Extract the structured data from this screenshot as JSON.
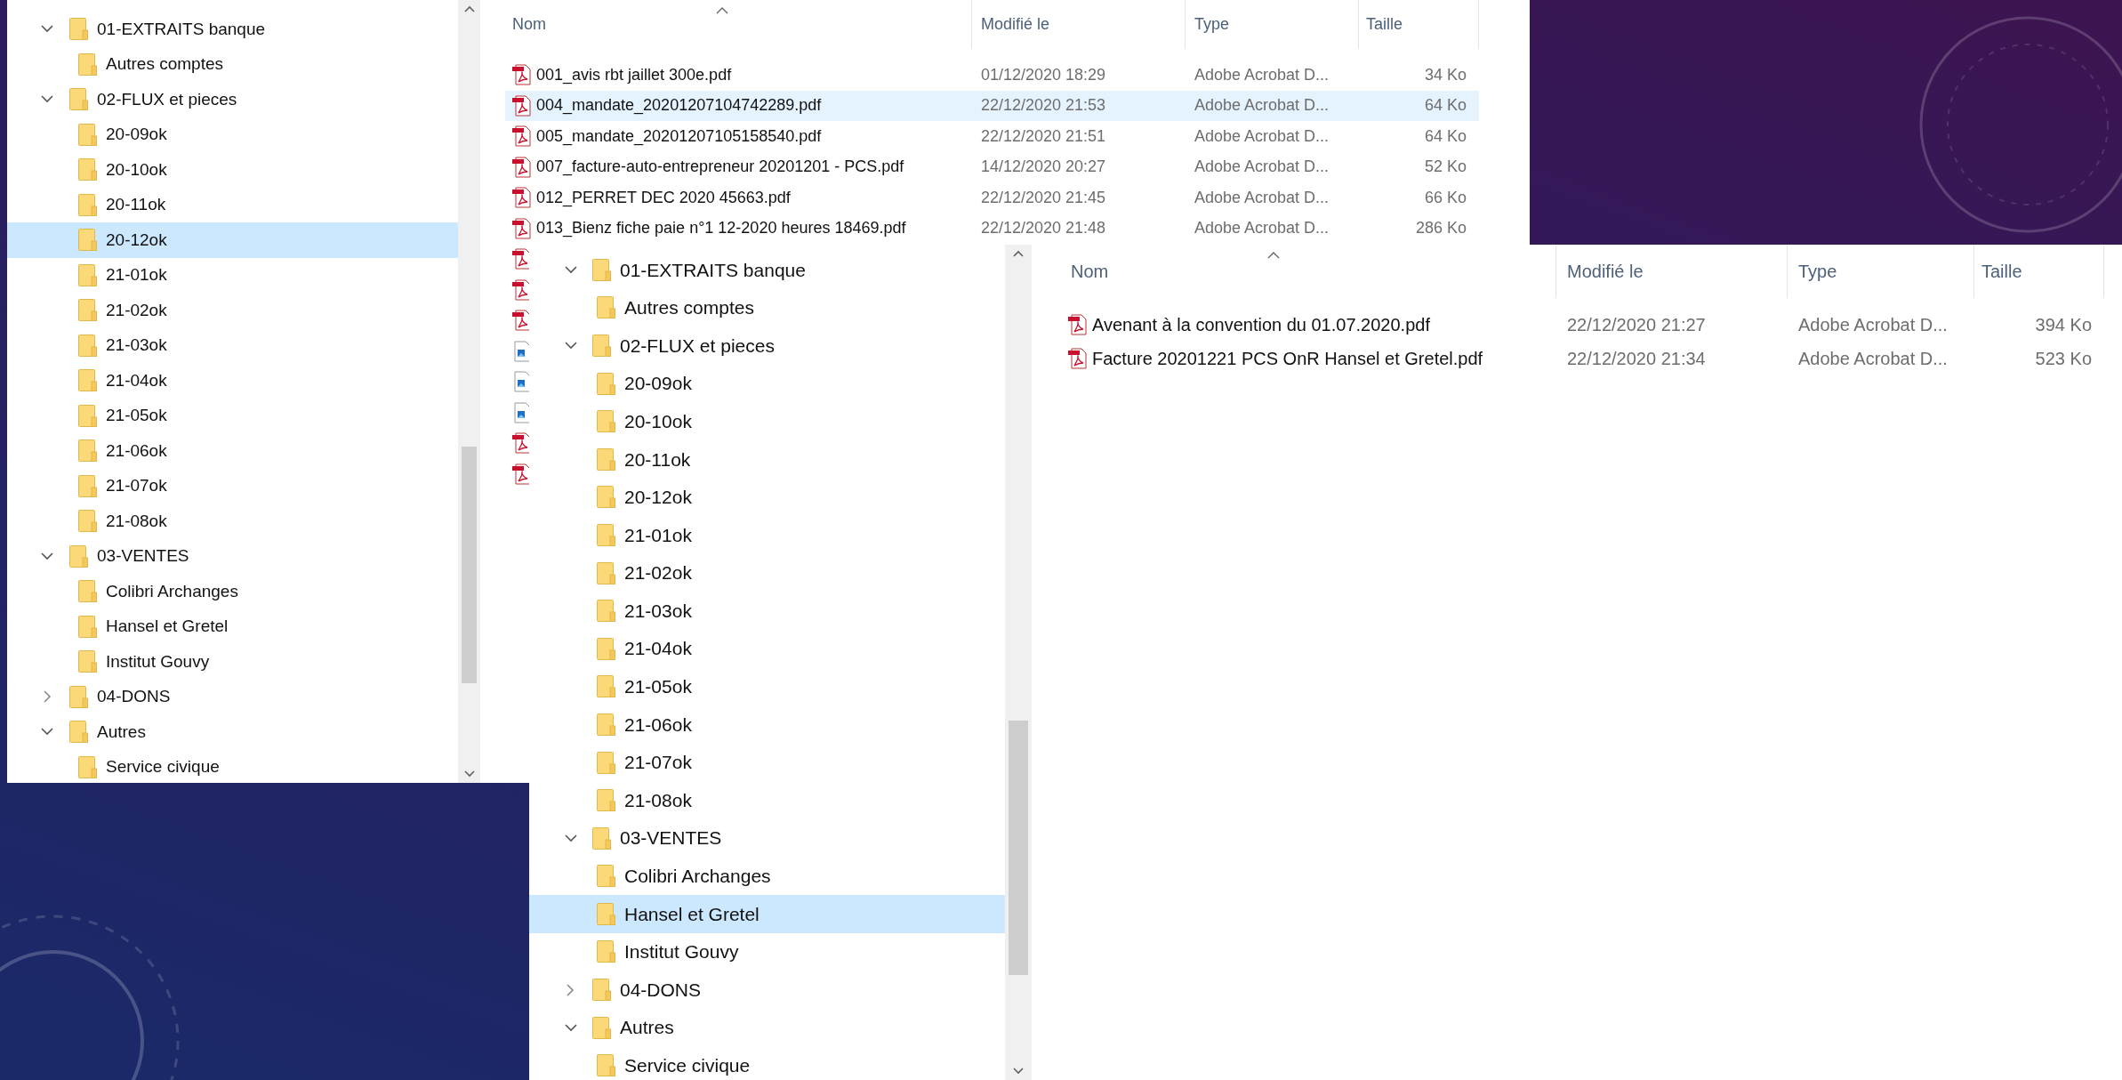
{
  "windows": [
    {
      "tree": [
        {
          "label": "01-EXTRAITS banque",
          "expanded": true,
          "selected": false,
          "children": [
            {
              "label": "Autres comptes",
              "selected": false
            }
          ]
        },
        {
          "label": "02-FLUX et pieces",
          "expanded": true,
          "selected": false,
          "children": [
            {
              "label": "20-09ok",
              "selected": false
            },
            {
              "label": "20-10ok",
              "selected": false
            },
            {
              "label": "20-11ok",
              "selected": false
            },
            {
              "label": "20-12ok",
              "selected": true
            },
            {
              "label": "21-01ok",
              "selected": false
            },
            {
              "label": "21-02ok",
              "selected": false
            },
            {
              "label": "21-03ok",
              "selected": false
            },
            {
              "label": "21-04ok",
              "selected": false
            },
            {
              "label": "21-05ok",
              "selected": false
            },
            {
              "label": "21-06ok",
              "selected": false
            },
            {
              "label": "21-07ok",
              "selected": false
            },
            {
              "label": "21-08ok",
              "selected": false
            }
          ]
        },
        {
          "label": "03-VENTES",
          "expanded": true,
          "selected": false,
          "children": [
            {
              "label": "Colibri Archanges",
              "selected": false
            },
            {
              "label": "Hansel et Gretel",
              "selected": false
            },
            {
              "label": "Institut Gouvy",
              "selected": false
            }
          ]
        },
        {
          "label": "04-DONS",
          "expanded": false,
          "selected": false
        },
        {
          "label": "Autres",
          "expanded": true,
          "selected": false,
          "children": [
            {
              "label": "Service civique",
              "selected": false
            }
          ]
        }
      ],
      "columns": [
        "Nom",
        "Modifié le",
        "Type",
        "Taille"
      ],
      "files": [
        {
          "kind": "pdf",
          "name": "001_avis rbt jaillet 300e.pdf",
          "modified": "01/12/2020 18:29",
          "type": "Adobe Acrobat D...",
          "size": "34 Ko",
          "selected": false
        },
        {
          "kind": "pdf",
          "name": "004_mandate_20201207104742289.pdf",
          "modified": "22/12/2020 21:53",
          "type": "Adobe Acrobat D...",
          "size": "64 Ko",
          "selected": true
        },
        {
          "kind": "pdf",
          "name": "005_mandate_20201207105158540.pdf",
          "modified": "22/12/2020 21:51",
          "type": "Adobe Acrobat D...",
          "size": "64 Ko",
          "selected": false
        },
        {
          "kind": "pdf",
          "name": "007_facture-auto-entrepreneur 20201201 - PCS.pdf",
          "modified": "14/12/2020 20:27",
          "type": "Adobe Acrobat D...",
          "size": "52 Ko",
          "selected": false
        },
        {
          "kind": "pdf",
          "name": "012_PERRET DEC 2020 45663.pdf",
          "modified": "22/12/2020 21:45",
          "type": "Adobe Acrobat D...",
          "size": "66 Ko",
          "selected": false
        },
        {
          "kind": "pdf",
          "name": "013_Bienz fiche paie n°1 12-2020 heures 18469.pdf",
          "modified": "22/12/2020 21:48",
          "type": "Adobe Acrobat D...",
          "size": "286 Ko",
          "selected": false
        },
        {
          "kind": "pdf",
          "selected": false
        },
        {
          "kind": "pdf",
          "selected": false
        },
        {
          "kind": "pdf",
          "selected": false
        },
        {
          "kind": "image",
          "selected": false
        },
        {
          "kind": "image",
          "selected": false
        },
        {
          "kind": "image",
          "selected": false
        },
        {
          "kind": "pdf",
          "selected": false
        },
        {
          "kind": "pdf",
          "selected": false
        }
      ]
    },
    {
      "tree": [
        {
          "label": "01-EXTRAITS banque",
          "expanded": true,
          "selected": false,
          "children": [
            {
              "label": "Autres comptes",
              "selected": false
            }
          ]
        },
        {
          "label": "02-FLUX et pieces",
          "expanded": true,
          "selected": false,
          "children": [
            {
              "label": "20-09ok",
              "selected": false
            },
            {
              "label": "20-10ok",
              "selected": false
            },
            {
              "label": "20-11ok",
              "selected": false
            },
            {
              "label": "20-12ok",
              "selected": false
            },
            {
              "label": "21-01ok",
              "selected": false
            },
            {
              "label": "21-02ok",
              "selected": false
            },
            {
              "label": "21-03ok",
              "selected": false
            },
            {
              "label": "21-04ok",
              "selected": false
            },
            {
              "label": "21-05ok",
              "selected": false
            },
            {
              "label": "21-06ok",
              "selected": false
            },
            {
              "label": "21-07ok",
              "selected": false
            },
            {
              "label": "21-08ok",
              "selected": false
            }
          ]
        },
        {
          "label": "03-VENTES",
          "expanded": true,
          "selected": false,
          "children": [
            {
              "label": "Colibri Archanges",
              "selected": false
            },
            {
              "label": "Hansel et Gretel",
              "selected": true
            },
            {
              "label": "Institut Gouvy",
              "selected": false
            }
          ]
        },
        {
          "label": "04-DONS",
          "expanded": false,
          "selected": false
        },
        {
          "label": "Autres",
          "expanded": true,
          "selected": false,
          "children": [
            {
              "label": "Service civique",
              "selected": false
            }
          ]
        }
      ],
      "columns": [
        "Nom",
        "Modifié le",
        "Type",
        "Taille"
      ],
      "files": [
        {
          "kind": "pdf",
          "name": "Avenant à la convention du 01.07.2020.pdf",
          "modified": "22/12/2020 21:27",
          "type": "Adobe Acrobat D...",
          "size": "394 Ko",
          "selected": false
        },
        {
          "kind": "pdf",
          "name": "Facture 20201221 PCS OnR Hansel et Gretel.pdf",
          "modified": "22/12/2020 21:34",
          "type": "Adobe Acrobat D...",
          "size": "523 Ko",
          "selected": false
        }
      ]
    }
  ]
}
